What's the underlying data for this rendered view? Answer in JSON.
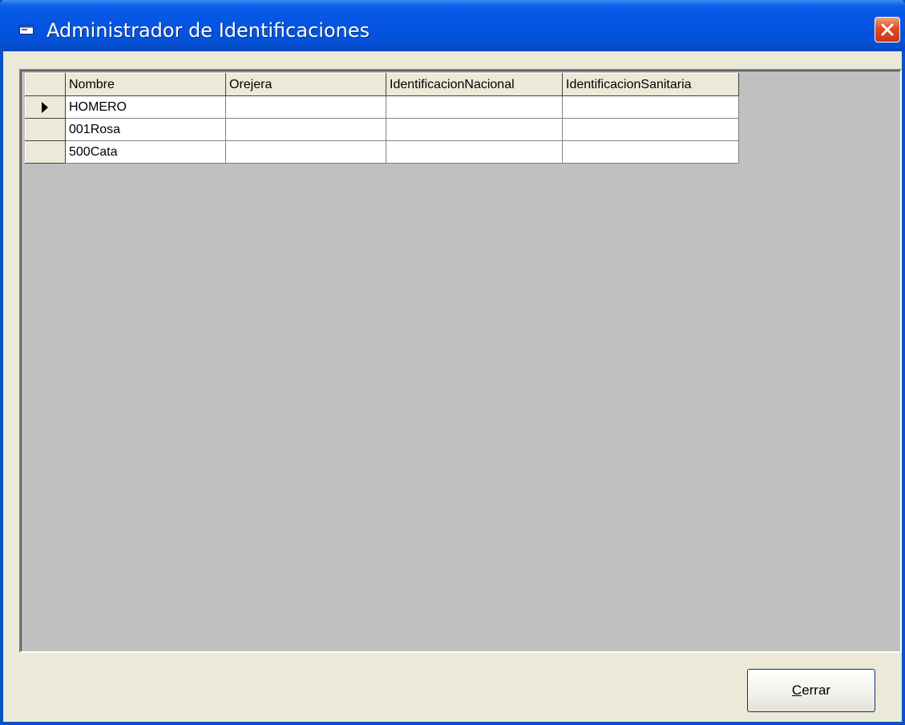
{
  "window": {
    "title": "Administrador de Identificaciones",
    "title_icon": "form-window-icon",
    "close_icon": "close-x-icon"
  },
  "grid": {
    "columns": [
      "Nombre",
      "Orejera",
      "IdentificacionNacional",
      "IdentificacionSanitaria"
    ],
    "current_row_indicator": "row-pointer-icon",
    "rows": [
      {
        "Nombre": "HOMERO",
        "Orejera": "",
        "IdentificacionNacional": "",
        "IdentificacionSanitaria": ""
      },
      {
        "Nombre": "001Rosa",
        "Orejera": "",
        "IdentificacionNacional": "",
        "IdentificacionSanitaria": ""
      },
      {
        "Nombre": "500Cata",
        "Orejera": "",
        "IdentificacionNacional": "",
        "IdentificacionSanitaria": ""
      }
    ],
    "selected_row": 0
  },
  "buttons": {
    "close_label_accel": "C",
    "close_label_rest": "errar"
  },
  "colors": {
    "titlebar": "#0554e3",
    "grid_background": "#c0c0c0",
    "window_face": "#ece9d8",
    "close_button": "#e04a1f"
  }
}
